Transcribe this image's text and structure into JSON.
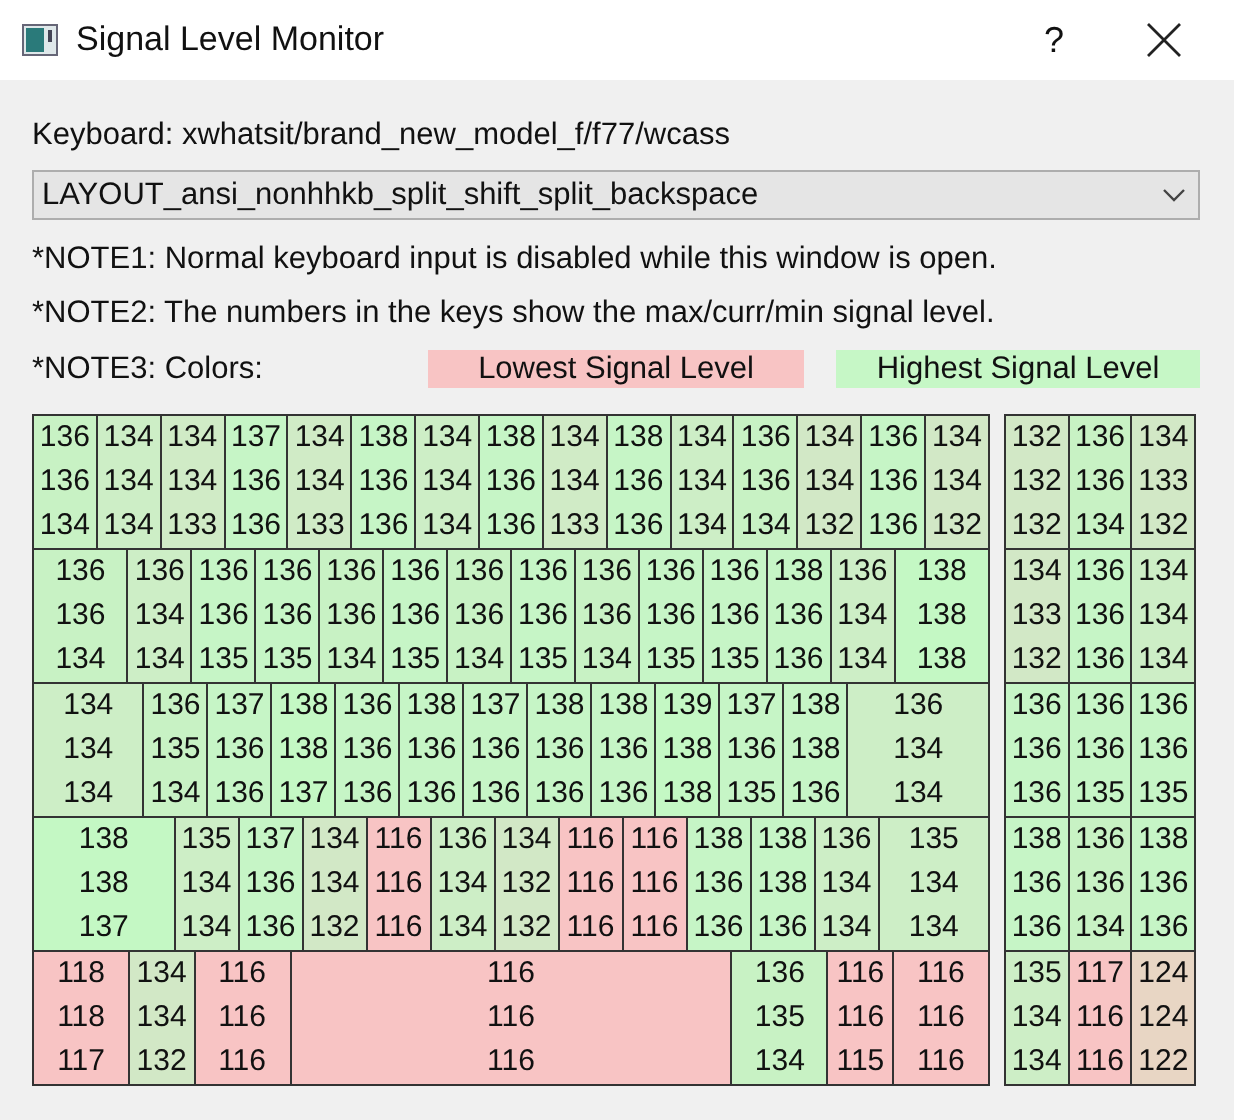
{
  "window": {
    "title": "Signal Level Monitor",
    "help_button": "?"
  },
  "keyboard_label": "Keyboard: xwhatsit/brand_new_model_f/f77/wcass",
  "layout_select": {
    "value": "LAYOUT_ansi_nonhhkb_split_shift_split_backspace"
  },
  "notes": [
    "*NOTE1: Normal keyboard input is disabled while this window is open.",
    "*NOTE2: The numbers in the keys show the max/curr/min signal level."
  ],
  "colors_note": {
    "label": "*NOTE3: Colors:",
    "legend": [
      {
        "label": "Lowest Signal Level",
        "color": "#f8c4c4"
      },
      {
        "label": "Highest Signal Level",
        "color": "#c6f7c6"
      }
    ]
  },
  "main_block": [
    {
      "keys": [
        {
          "max": "136",
          "curr": "136",
          "min": "134",
          "color": "#c8f2c4"
        },
        {
          "max": "134",
          "curr": "134",
          "min": "134",
          "color": "#cdeec6"
        },
        {
          "max": "134",
          "curr": "134",
          "min": "133",
          "color": "#d0ebc6"
        },
        {
          "max": "137",
          "curr": "136",
          "min": "136",
          "color": "#c6f5c6"
        },
        {
          "max": "134",
          "curr": "134",
          "min": "133",
          "color": "#d0ebc6"
        },
        {
          "max": "138",
          "curr": "136",
          "min": "136",
          "color": "#c6f5c6"
        },
        {
          "max": "134",
          "curr": "134",
          "min": "134",
          "color": "#cdeec6"
        },
        {
          "max": "138",
          "curr": "136",
          "min": "136",
          "color": "#c6f5c6"
        },
        {
          "max": "134",
          "curr": "134",
          "min": "133",
          "color": "#d0ebc6"
        },
        {
          "max": "138",
          "curr": "136",
          "min": "136",
          "color": "#c6f5c6"
        },
        {
          "max": "134",
          "curr": "134",
          "min": "134",
          "color": "#cdeec6"
        },
        {
          "max": "136",
          "curr": "136",
          "min": "134",
          "color": "#c8f2c4"
        },
        {
          "max": "134",
          "curr": "134",
          "min": "132",
          "color": "#d2e8c6"
        },
        {
          "max": "136",
          "curr": "136",
          "min": "136",
          "color": "#c6f5c6"
        },
        {
          "max": "134",
          "curr": "134",
          "min": "132",
          "color": "#d2e8c6"
        }
      ]
    },
    {
      "keys": [
        {
          "max": "136",
          "curr": "136",
          "min": "134",
          "color": "#c8f2c4"
        },
        {
          "max": "136",
          "curr": "134",
          "min": "134",
          "color": "#cdeec6"
        },
        {
          "max": "136",
          "curr": "136",
          "min": "135",
          "color": "#c6f5c6"
        },
        {
          "max": "136",
          "curr": "136",
          "min": "135",
          "color": "#c6f5c6"
        },
        {
          "max": "136",
          "curr": "136",
          "min": "134",
          "color": "#c8f2c4"
        },
        {
          "max": "136",
          "curr": "136",
          "min": "135",
          "color": "#c6f5c6"
        },
        {
          "max": "136",
          "curr": "136",
          "min": "134",
          "color": "#c8f2c4"
        },
        {
          "max": "136",
          "curr": "136",
          "min": "135",
          "color": "#c6f5c6"
        },
        {
          "max": "136",
          "curr": "136",
          "min": "134",
          "color": "#c8f2c4"
        },
        {
          "max": "136",
          "curr": "136",
          "min": "135",
          "color": "#c6f5c6"
        },
        {
          "max": "136",
          "curr": "136",
          "min": "135",
          "color": "#c6f5c6"
        },
        {
          "max": "138",
          "curr": "136",
          "min": "136",
          "color": "#c6f5c6"
        },
        {
          "max": "136",
          "curr": "134",
          "min": "134",
          "color": "#cdeec6"
        },
        {
          "max": "138",
          "curr": "138",
          "min": "138",
          "color": "#c4f8c4"
        }
      ]
    },
    {
      "keys": [
        {
          "max": "134",
          "curr": "134",
          "min": "134",
          "color": "#cdeec6"
        },
        {
          "max": "136",
          "curr": "135",
          "min": "134",
          "color": "#c8f2c4"
        },
        {
          "max": "137",
          "curr": "136",
          "min": "136",
          "color": "#c6f5c6"
        },
        {
          "max": "138",
          "curr": "138",
          "min": "137",
          "color": "#c4f8c4"
        },
        {
          "max": "136",
          "curr": "136",
          "min": "136",
          "color": "#c6f5c6"
        },
        {
          "max": "138",
          "curr": "136",
          "min": "136",
          "color": "#c6f5c6"
        },
        {
          "max": "137",
          "curr": "136",
          "min": "136",
          "color": "#c6f5c6"
        },
        {
          "max": "138",
          "curr": "136",
          "min": "136",
          "color": "#c6f5c6"
        },
        {
          "max": "138",
          "curr": "136",
          "min": "136",
          "color": "#c6f5c6"
        },
        {
          "max": "139",
          "curr": "138",
          "min": "138",
          "color": "#c4f8c4"
        },
        {
          "max": "137",
          "curr": "136",
          "min": "135",
          "color": "#c6f5c6"
        },
        {
          "max": "138",
          "curr": "138",
          "min": "136",
          "color": "#c6f5c6"
        },
        {
          "max": "136",
          "curr": "134",
          "min": "134",
          "color": "#cdeec6"
        }
      ]
    },
    {
      "keys": [
        {
          "max": "138",
          "curr": "138",
          "min": "137",
          "color": "#c4f8c4"
        },
        {
          "max": "135",
          "curr": "134",
          "min": "134",
          "color": "#cdeec6"
        },
        {
          "max": "137",
          "curr": "136",
          "min": "136",
          "color": "#c6f5c6"
        },
        {
          "max": "134",
          "curr": "134",
          "min": "132",
          "color": "#d2e8c6"
        },
        {
          "max": "116",
          "curr": "116",
          "min": "116",
          "color": "#f8c4c4"
        },
        {
          "max": "136",
          "curr": "134",
          "min": "134",
          "color": "#cdeec6"
        },
        {
          "max": "134",
          "curr": "132",
          "min": "132",
          "color": "#d2e8c6"
        },
        {
          "max": "116",
          "curr": "116",
          "min": "116",
          "color": "#f8c4c4"
        },
        {
          "max": "116",
          "curr": "116",
          "min": "116",
          "color": "#f8c4c4"
        },
        {
          "max": "138",
          "curr": "136",
          "min": "136",
          "color": "#c6f5c6"
        },
        {
          "max": "138",
          "curr": "138",
          "min": "136",
          "color": "#c6f5c6"
        },
        {
          "max": "136",
          "curr": "134",
          "min": "134",
          "color": "#cdeec6"
        },
        {
          "max": "135",
          "curr": "134",
          "min": "134",
          "color": "#cdeec6"
        }
      ]
    },
    {
      "keys": [
        {
          "max": "118",
          "curr": "118",
          "min": "117",
          "color": "#f8c4c4"
        },
        {
          "max": "134",
          "curr": "134",
          "min": "132",
          "color": "#d2e8c6"
        },
        {
          "max": "116",
          "curr": "116",
          "min": "116",
          "color": "#f8c4c4"
        },
        {
          "max": "116",
          "curr": "116",
          "min": "116",
          "color": "#f8c4c4"
        },
        {
          "max": "136",
          "curr": "135",
          "min": "134",
          "color": "#c8f2c4"
        },
        {
          "max": "116",
          "curr": "116",
          "min": "115",
          "color": "#f8c4c4"
        },
        {
          "max": "116",
          "curr": "116",
          "min": "116",
          "color": "#f8c4c4"
        }
      ]
    }
  ],
  "nav_block": [
    {
      "keys": [
        {
          "max": "132",
          "curr": "132",
          "min": "132",
          "color": "#d2e8c6"
        },
        {
          "max": "136",
          "curr": "136",
          "min": "134",
          "color": "#c8f2c4"
        },
        {
          "max": "134",
          "curr": "133",
          "min": "132",
          "color": "#d2e8c6"
        }
      ]
    },
    {
      "keys": [
        {
          "max": "134",
          "curr": "133",
          "min": "132",
          "color": "#d2e8c6"
        },
        {
          "max": "136",
          "curr": "136",
          "min": "136",
          "color": "#c6f5c6"
        },
        {
          "max": "134",
          "curr": "134",
          "min": "134",
          "color": "#cdeec6"
        }
      ]
    },
    {
      "keys": [
        {
          "max": "136",
          "curr": "136",
          "min": "136",
          "color": "#c6f5c6"
        },
        {
          "max": "136",
          "curr": "136",
          "min": "135",
          "color": "#c6f5c6"
        },
        {
          "max": "136",
          "curr": "136",
          "min": "135",
          "color": "#c6f5c6"
        }
      ]
    },
    {
      "keys": [
        {
          "max": "138",
          "curr": "136",
          "min": "136",
          "color": "#c6f5c6"
        },
        {
          "max": "136",
          "curr": "136",
          "min": "134",
          "color": "#c8f2c4"
        },
        {
          "max": "138",
          "curr": "136",
          "min": "136",
          "color": "#c6f5c6"
        }
      ]
    },
    {
      "keys": [
        {
          "max": "135",
          "curr": "134",
          "min": "134",
          "color": "#cdeec6"
        },
        {
          "max": "117",
          "curr": "116",
          "min": "116",
          "color": "#f8c4c4"
        },
        {
          "max": "124",
          "curr": "124",
          "min": "122",
          "color": "#e8d6c4"
        }
      ]
    }
  ]
}
